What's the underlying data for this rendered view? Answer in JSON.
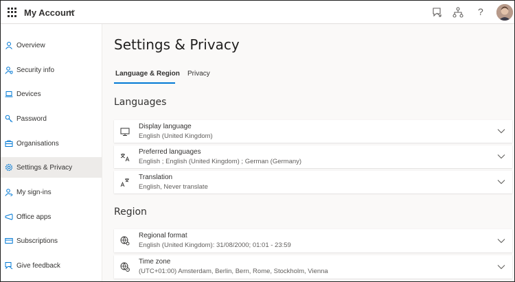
{
  "header": {
    "app_title": "My Account",
    "help_label": "?",
    "icons": [
      "waffle-icon",
      "chevron-down-icon",
      "feedback-icon",
      "org-chart-icon",
      "help-icon",
      "avatar"
    ]
  },
  "sidebar": {
    "items": [
      {
        "label": "Overview",
        "icon": "person-icon",
        "active": false
      },
      {
        "label": "Security info",
        "icon": "security-person-icon",
        "active": false
      },
      {
        "label": "Devices",
        "icon": "laptop-icon",
        "active": false
      },
      {
        "label": "Password",
        "icon": "key-icon",
        "active": false
      },
      {
        "label": "Organisations",
        "icon": "briefcase-icon",
        "active": false
      },
      {
        "label": "Settings & Privacy",
        "icon": "gear-icon",
        "active": true
      },
      {
        "label": "My sign-ins",
        "icon": "person-signin-icon",
        "active": false
      },
      {
        "label": "Office apps",
        "icon": "office-apps-icon",
        "active": false
      },
      {
        "label": "Subscriptions",
        "icon": "card-icon",
        "active": false
      },
      {
        "label": "Give feedback",
        "icon": "feedback-icon",
        "active": false
      }
    ]
  },
  "main": {
    "title": "Settings & Privacy",
    "tabs": [
      {
        "label": "Language & Region",
        "active": true
      },
      {
        "label": "Privacy",
        "active": false
      }
    ],
    "sections": {
      "languages": {
        "title": "Languages",
        "cards": [
          {
            "title": "Display language",
            "value": "English (United Kingdom)",
            "icon": "monitor-icon"
          },
          {
            "title": "Preferred languages",
            "value": "English ; English (United Kingdom) ; German (Germany)",
            "icon": "language-icon"
          },
          {
            "title": "Translation",
            "value": "English, Never translate",
            "icon": "translate-icon"
          }
        ]
      },
      "region": {
        "title": "Region",
        "cards": [
          {
            "title": "Regional format",
            "value": "English (United Kingdom): 31/08/2000; 01:01 - 23:59",
            "icon": "globe-settings-icon"
          },
          {
            "title": "Time zone",
            "value": "(UTC+01:00) Amsterdam, Berlin, Bern, Rome, Stockholm, Vienna",
            "icon": "globe-clock-icon"
          }
        ]
      }
    }
  },
  "colors": {
    "accent": "#0078d4",
    "active_nav_bg": "#edebe9",
    "page_bg": "#faf9f8",
    "text": "#323130",
    "secondary_text": "#605e5c"
  }
}
